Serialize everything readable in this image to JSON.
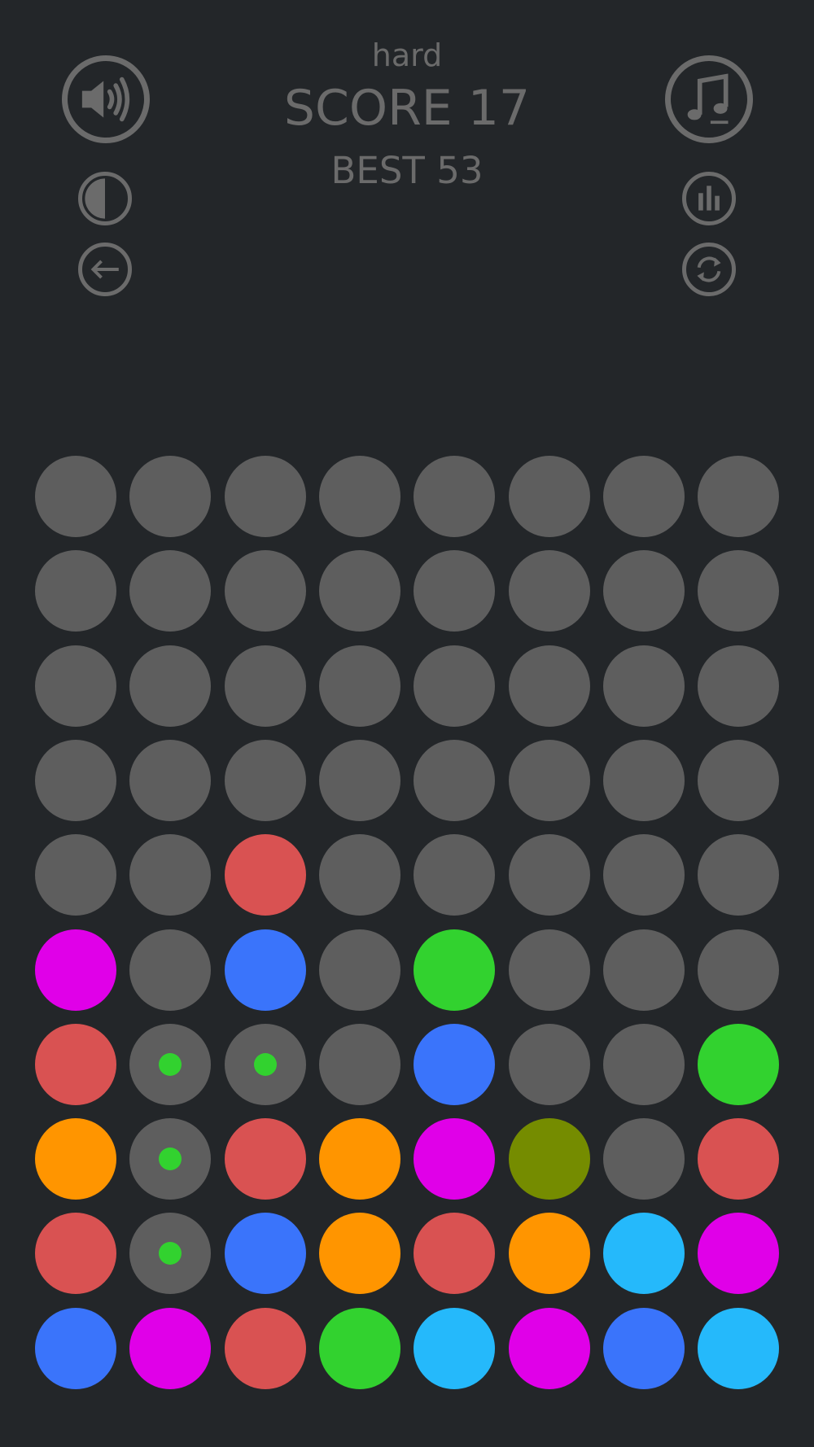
{
  "hud": {
    "difficulty": "hard",
    "score_label": "SCORE 17",
    "best_label": "BEST 53",
    "score": 17,
    "best": 53
  },
  "controls": [
    {
      "id": "sound-btn",
      "icon": "speaker-icon"
    },
    {
      "id": "music-btn",
      "icon": "music-note-icon"
    },
    {
      "id": "contrast-btn",
      "icon": "contrast-icon"
    },
    {
      "id": "stats-btn",
      "icon": "bar-chart-icon"
    },
    {
      "id": "back-btn",
      "icon": "arrow-left-icon"
    },
    {
      "id": "restart-btn",
      "icon": "restart-icon"
    }
  ],
  "colors": {
    "empty": "#5e5e5e",
    "red": "#d95252",
    "magenta": "#e000e8",
    "blue": "#3a74fb",
    "green": "#32d22f",
    "orange": "#ff9500",
    "olive": "#758c00",
    "cyan": "#25b9fb",
    "marker": "#32d22f",
    "icon_gray": "#6b6b6b"
  },
  "board": {
    "rows": 10,
    "cols": 8,
    "cells": [
      [
        "empty",
        "empty",
        "empty",
        "empty",
        "empty",
        "empty",
        "empty",
        "empty"
      ],
      [
        "empty",
        "empty",
        "empty",
        "empty",
        "empty",
        "empty",
        "empty",
        "empty"
      ],
      [
        "empty",
        "empty",
        "empty",
        "empty",
        "empty",
        "empty",
        "empty",
        "empty"
      ],
      [
        "empty",
        "empty",
        "empty",
        "empty",
        "empty",
        "empty",
        "empty",
        "empty"
      ],
      [
        "empty",
        "empty",
        "red",
        "empty",
        "empty",
        "empty",
        "empty",
        "empty"
      ],
      [
        "magenta",
        "empty",
        "blue",
        "empty",
        "green",
        "empty",
        "empty",
        "empty"
      ],
      [
        "red",
        "empty",
        "empty",
        "empty",
        "blue",
        "empty",
        "empty",
        "green"
      ],
      [
        "orange",
        "empty",
        "red",
        "orange",
        "magenta",
        "olive",
        "empty",
        "red"
      ],
      [
        "red",
        "empty",
        "blue",
        "orange",
        "red",
        "orange",
        "cyan",
        "magenta"
      ],
      [
        "blue",
        "magenta",
        "red",
        "green",
        "cyan",
        "magenta",
        "blue",
        "cyan"
      ]
    ],
    "path_markers": [
      [
        6,
        1
      ],
      [
        6,
        2
      ],
      [
        7,
        1
      ],
      [
        8,
        1
      ]
    ]
  }
}
